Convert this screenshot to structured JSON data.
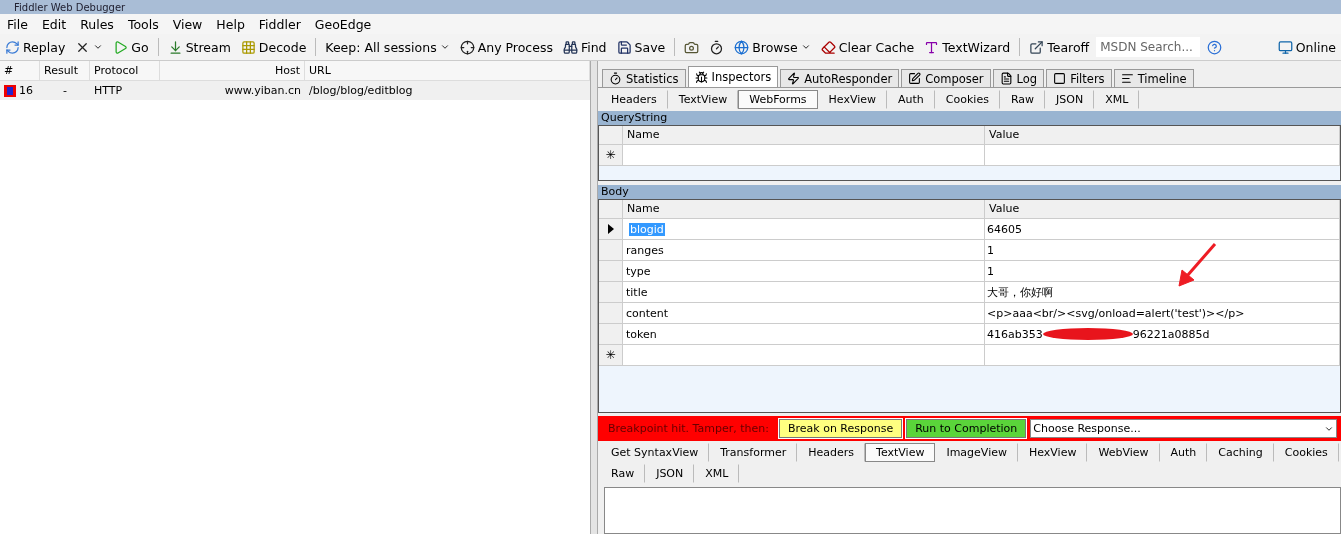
{
  "window": {
    "title": "Fiddler Web Debugger"
  },
  "menu": [
    "File",
    "Edit",
    "Rules",
    "Tools",
    "View",
    "Help",
    "Fiddler",
    "GeoEdge"
  ],
  "toolbar": [
    {
      "kind": "button",
      "label": "Replay"
    },
    {
      "kind": "dropdown"
    },
    {
      "kind": "button",
      "label": "Go"
    },
    {
      "kind": "separator"
    },
    {
      "kind": "button",
      "label": "Stream"
    },
    {
      "kind": "button",
      "label": "Decode"
    },
    {
      "kind": "separator"
    },
    {
      "kind": "dropdown",
      "label": "Keep: All sessions"
    },
    {
      "kind": "button",
      "label": "Any Process"
    },
    {
      "kind": "button",
      "label": "Find"
    },
    {
      "kind": "button",
      "label": "Save"
    },
    {
      "kind": "separator"
    },
    {
      "kind": "button"
    },
    {
      "kind": "button"
    },
    {
      "kind": "dropdown",
      "label": "Browse"
    },
    {
      "kind": "button",
      "label": "Clear Cache"
    },
    {
      "kind": "button",
      "label": "TextWizard"
    },
    {
      "kind": "separator"
    },
    {
      "kind": "button",
      "label": "Tearoff"
    },
    {
      "kind": "search",
      "placeholder": "MSDN Search..."
    },
    {
      "kind": "button"
    },
    {
      "kind": "spacer"
    },
    {
      "kind": "button",
      "label": "Online"
    }
  ],
  "sessions": {
    "columns": [
      "#",
      "Result",
      "Protocol",
      "Host",
      "URL"
    ],
    "rows": [
      {
        "number": "16",
        "result": "-",
        "protocol": "HTTP",
        "host": "www.yiban.cn",
        "url": "/blog/blog/editblog",
        "selected": false
      }
    ]
  },
  "main_tabs": [
    {
      "label": "Statistics",
      "selected": false
    },
    {
      "label": "Inspectors",
      "selected": true
    },
    {
      "label": "AutoResponder",
      "selected": false
    },
    {
      "label": "Composer",
      "selected": false
    },
    {
      "label": "Log",
      "selected": false
    },
    {
      "label": "Filters",
      "selected": false
    },
    {
      "label": "Timeline",
      "selected": false
    }
  ],
  "request_tabs": [
    {
      "label": "Headers",
      "selected": false
    },
    {
      "label": "TextView",
      "selected": false
    },
    {
      "label": "WebForms",
      "selected": true
    },
    {
      "label": "HexView",
      "selected": false
    },
    {
      "label": "Auth",
      "selected": false
    },
    {
      "label": "Cookies",
      "selected": false
    },
    {
      "label": "Raw",
      "selected": false
    },
    {
      "label": "JSON",
      "selected": false
    },
    {
      "label": "XML",
      "selected": false
    }
  ],
  "querystring": {
    "title": "QueryString",
    "columns": [
      "Name",
      "Value"
    ],
    "new_row_mark": "✳"
  },
  "body": {
    "title": "Body",
    "columns": [
      "Name",
      "Value"
    ],
    "new_row_mark": "✳",
    "annotation_arrow": true,
    "rows": [
      {
        "name": "blogid",
        "value": "64605",
        "selected": true
      },
      {
        "name": "ranges",
        "value": "1",
        "selected": false
      },
      {
        "name": "type",
        "value": "1",
        "selected": false
      },
      {
        "name": "title",
        "value": "大哥，你好啊",
        "selected": false
      },
      {
        "name": "content",
        "value": "<p>aaa<br/><svg/onload=alert('test')></p>",
        "selected": false
      },
      {
        "name": "token",
        "value": "416ab353",
        "value_after": "96221a0885d",
        "redacted": true,
        "selected": false
      }
    ]
  },
  "breakpoint_bar": {
    "message": "Breakpoint hit. Tamper, then:",
    "break_button": "Break on Response",
    "run_button": "Run to Completion",
    "response_select": "Choose Response..."
  },
  "response_tabs": [
    {
      "label": "Get SyntaxView",
      "selected": false
    },
    {
      "label": "Transformer",
      "selected": false
    },
    {
      "label": "Headers",
      "selected": false
    },
    {
      "label": "TextView",
      "selected": true
    },
    {
      "label": "ImageView",
      "selected": false
    },
    {
      "label": "HexView",
      "selected": false
    },
    {
      "label": "WebView",
      "selected": false
    },
    {
      "label": "Auth",
      "selected": false
    },
    {
      "label": "Caching",
      "selected": false
    },
    {
      "label": "Cookies",
      "selected": false
    },
    {
      "label": "Raw",
      "selected": false
    },
    {
      "label": "JSON",
      "selected": false
    },
    {
      "label": "XML",
      "selected": false
    }
  ]
}
